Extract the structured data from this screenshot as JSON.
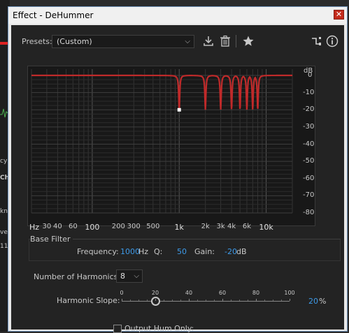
{
  "background": {
    "fragments": [
      "cy",
      "Ch",
      "kn",
      "ve",
      "11"
    ]
  },
  "window": {
    "title": "Effect - DeHummer",
    "close_glyph": "✕"
  },
  "toolbar": {
    "presets_label": "Presets:",
    "preset_value": "(Custom)",
    "icons": [
      "download-icon",
      "trash-icon",
      "star-icon",
      "routing-icon",
      "info-icon"
    ]
  },
  "graph": {
    "db_unit": "dB",
    "db_ticks": [
      "0",
      "-10",
      "-20",
      "-30",
      "-40",
      "-50",
      "-60",
      "-70",
      "-80"
    ],
    "hz_ticks": [
      "Hz",
      "30",
      "40",
      "60",
      "100",
      "200",
      "300",
      "500",
      "1k",
      "2k",
      "3k",
      "4k",
      "6k",
      "10k"
    ],
    "hz_major": [
      "100",
      "1k",
      "10k"
    ],
    "curve_color": "#c02a2a",
    "handle_color": "#ffffff"
  },
  "base_filter": {
    "title": "Base Filter",
    "frequency_label": "Frequency:",
    "frequency_value": "1000",
    "frequency_unit": "Hz",
    "q_label": "Q:",
    "q_value": "50",
    "gain_label": "Gain:",
    "gain_value": "-20",
    "gain_unit": "dB"
  },
  "harmonics": {
    "label": "Number of Harmonics:",
    "value": "8"
  },
  "slope": {
    "label": "Harmonic Slope:",
    "ticks": [
      "0",
      "20",
      "40",
      "60",
      "80",
      "100"
    ],
    "value": "20",
    "unit": "%",
    "fraction": 0.2
  },
  "output_hum": {
    "label": "Output Hum Only:",
    "checked": false
  },
  "colors": {
    "accent": "#3d9ae8",
    "panel": "#232323",
    "text": "#c8c8c8"
  }
}
